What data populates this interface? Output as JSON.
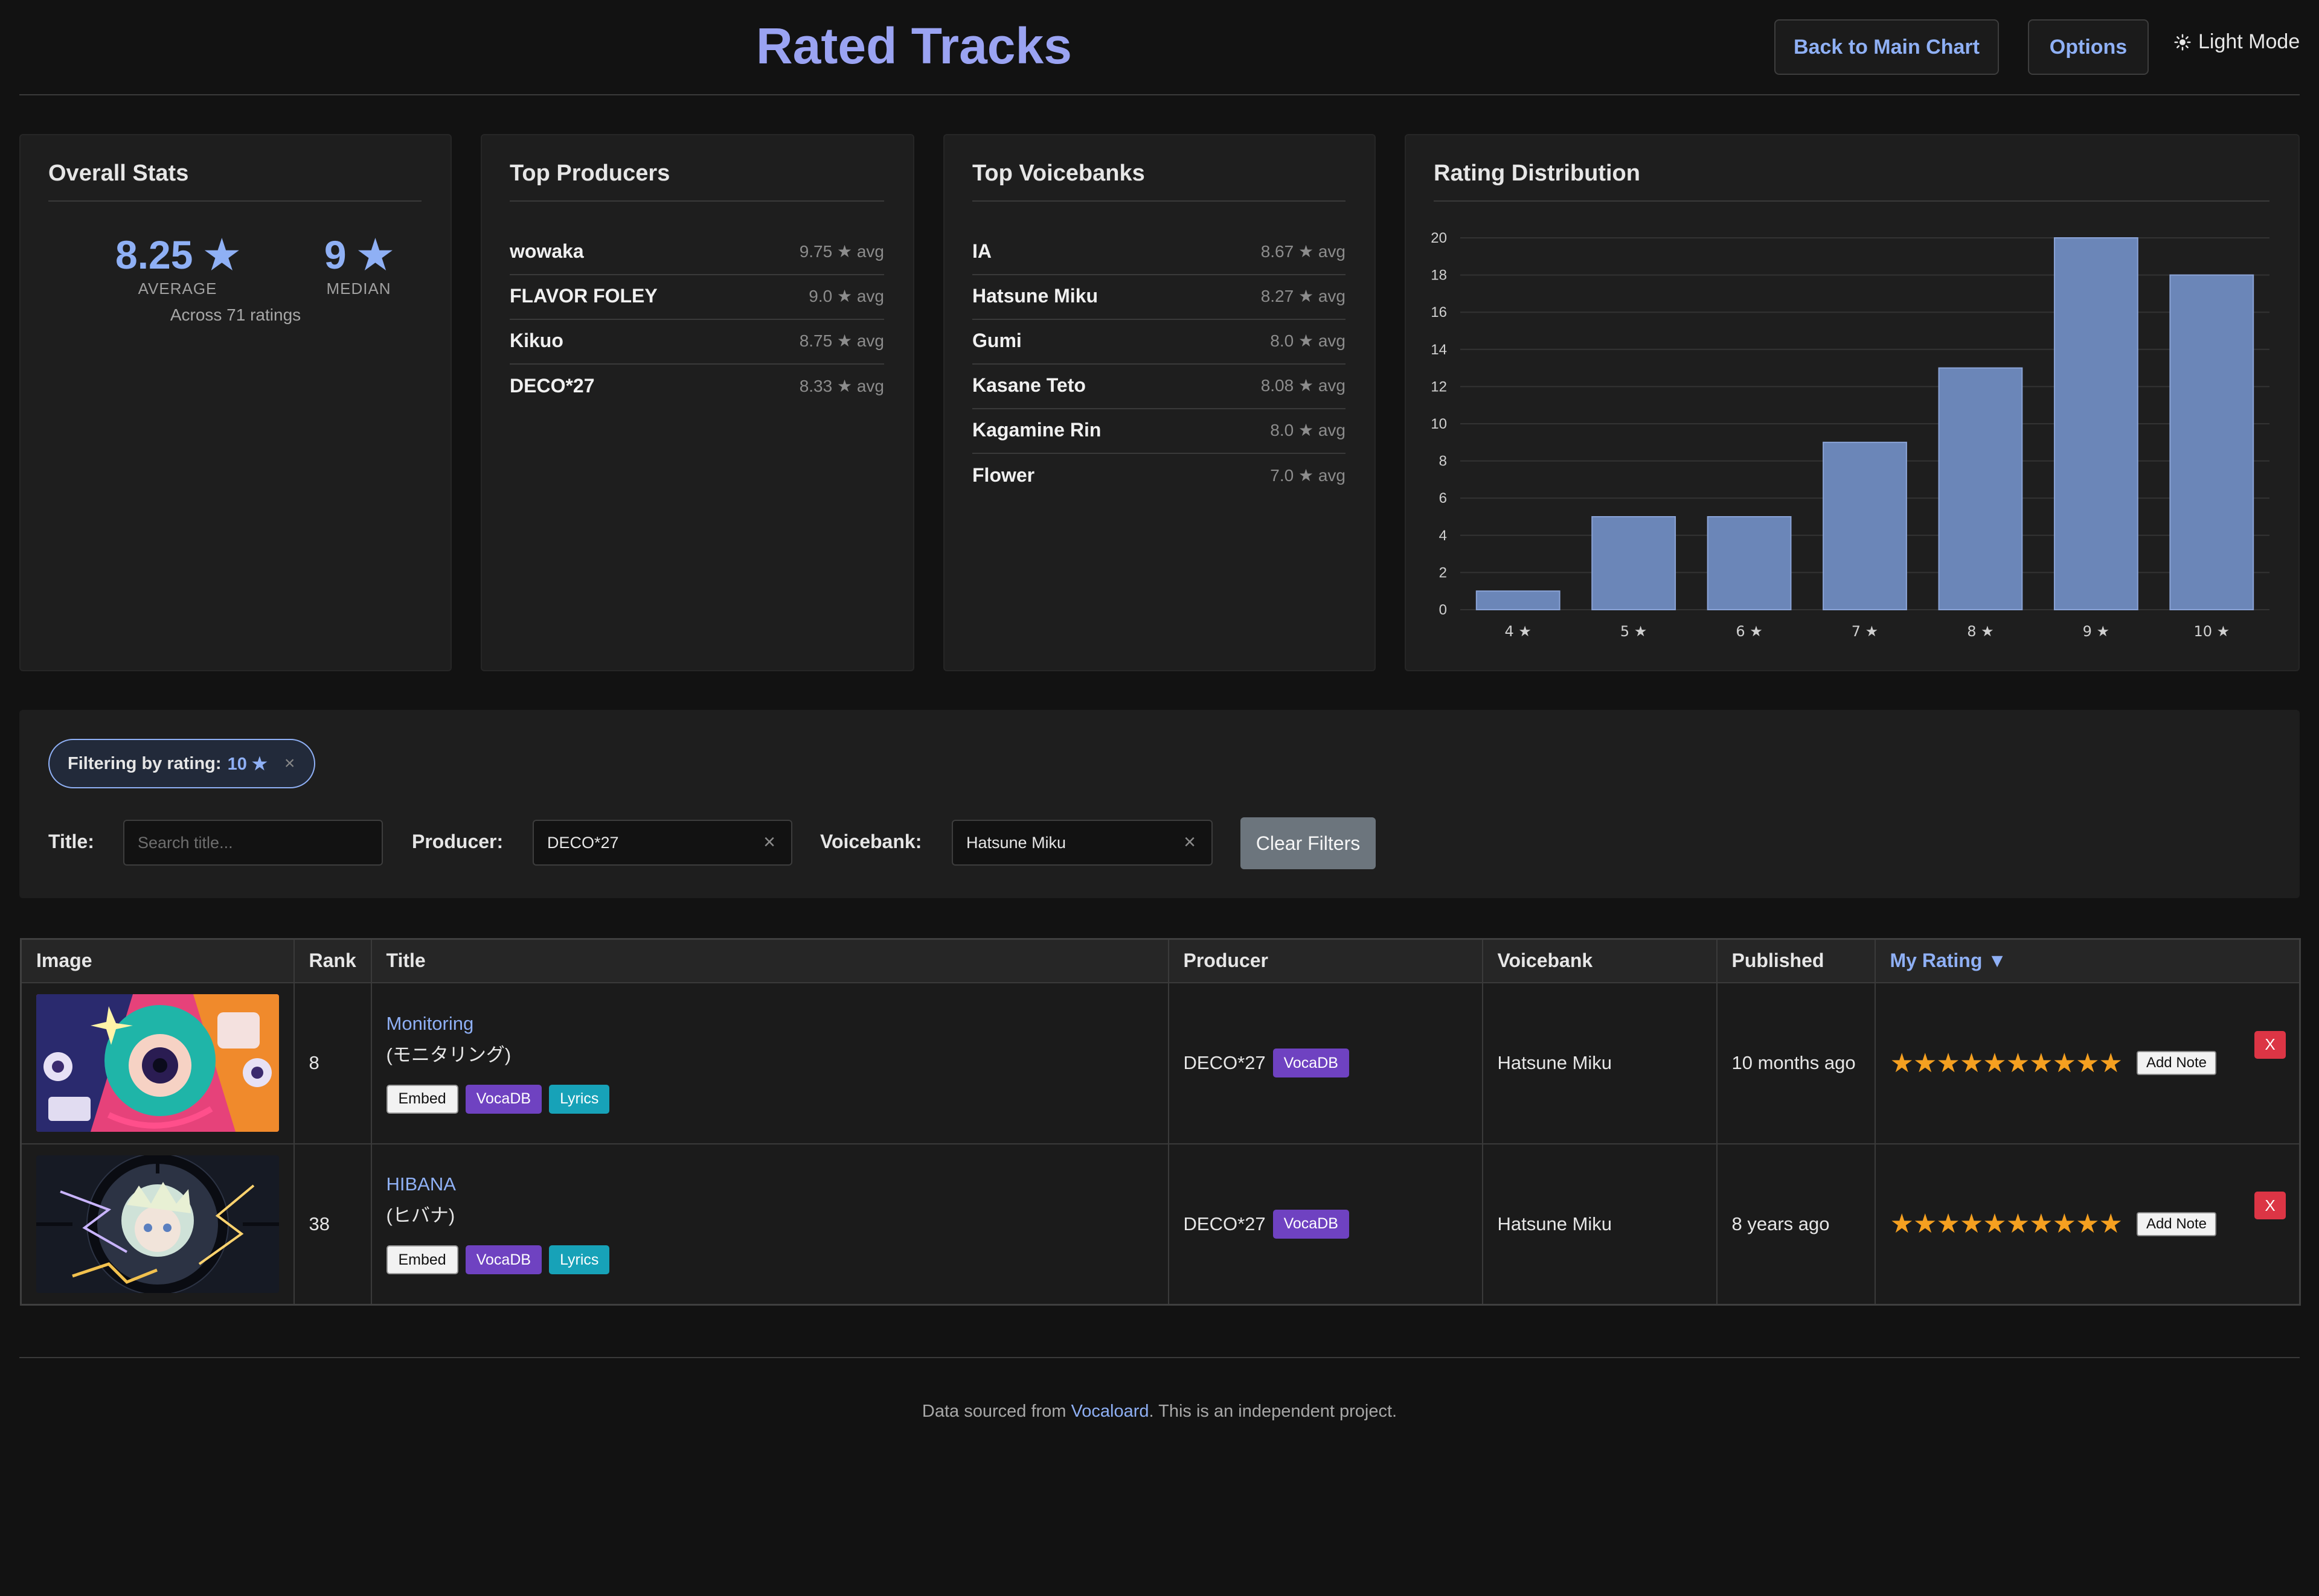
{
  "header": {
    "title": "Rated Tracks",
    "back_label": "Back to Main Chart",
    "options_label": "Options",
    "theme_label": "Light Mode"
  },
  "overall_stats": {
    "title": "Overall Stats",
    "average_value": "8.25 ★",
    "average_label": "AVERAGE",
    "median_value": "9 ★",
    "median_label": "MEDIAN",
    "caption": "Across 71 ratings"
  },
  "top_producers": {
    "title": "Top Producers",
    "items": [
      {
        "name": "wowaka",
        "avg": "9.75 ★ avg"
      },
      {
        "name": "FLAVOR FOLEY",
        "avg": "9.0 ★ avg"
      },
      {
        "name": "Kikuo",
        "avg": "8.75 ★ avg"
      },
      {
        "name": "DECO*27",
        "avg": "8.33 ★ avg"
      }
    ]
  },
  "top_voicebanks": {
    "title": "Top Voicebanks",
    "items": [
      {
        "name": "IA",
        "avg": "8.67 ★ avg"
      },
      {
        "name": "Hatsune Miku",
        "avg": "8.27 ★ avg"
      },
      {
        "name": "Gumi",
        "avg": "8.0 ★ avg"
      },
      {
        "name": "Kasane Teto",
        "avg": "8.08 ★ avg"
      },
      {
        "name": "Kagamine Rin",
        "avg": "8.0 ★ avg"
      },
      {
        "name": "Flower",
        "avg": "7.0 ★ avg"
      }
    ]
  },
  "rating_distribution": {
    "title": "Rating Distribution"
  },
  "chart_data": {
    "type": "bar",
    "title": "Rating Distribution",
    "categories": [
      "4 ★",
      "5 ★",
      "6 ★",
      "7 ★",
      "8 ★",
      "9 ★",
      "10 ★"
    ],
    "values": [
      1,
      5,
      5,
      9,
      13,
      20,
      18
    ],
    "ylim": [
      0,
      20
    ],
    "yticks": [
      0,
      2,
      4,
      6,
      8,
      10,
      12,
      14,
      16,
      18,
      20
    ],
    "grid": true,
    "bar_color": "#6b86b8"
  },
  "filters": {
    "pill_prefix": "Filtering by rating:",
    "pill_value": "10 ★",
    "pill_close": "×",
    "title_label": "Title:",
    "title_placeholder": "Search title...",
    "producer_label": "Producer:",
    "producer_value": "DECO*27",
    "voicebank_label": "Voicebank:",
    "voicebank_value": "Hatsune Miku",
    "clear_x": "×",
    "clear_button": "Clear Filters"
  },
  "table": {
    "headers": [
      "Image",
      "Rank",
      "Title",
      "Producer",
      "Voicebank",
      "Published",
      "My Rating ▼"
    ],
    "rows": [
      {
        "rank": "8",
        "title": "Monitoring",
        "title_sub": "(モニタリング)",
        "producer": "DECO*27",
        "voicebank": "Hatsune Miku",
        "published": "10 months ago",
        "stars": "★★★★★★★★★★"
      },
      {
        "rank": "38",
        "title": "HIBANA",
        "title_sub": "(ヒバナ)",
        "producer": "DECO*27",
        "voicebank": "Hatsune Miku",
        "published": "8 years ago",
        "stars": "★★★★★★★★★★"
      }
    ],
    "badge_embed": "Embed",
    "badge_vocadb": "VocaDB",
    "badge_lyrics": "Lyrics",
    "add_note": "Add Note",
    "delete": "X"
  },
  "footer": {
    "prefix": "Data sourced from ",
    "link": "Vocaloard",
    "suffix": ". This is an independent project."
  },
  "colors": {
    "background": "#121212",
    "card": "#1e1e1e",
    "accent": "#8fb0f5",
    "title": "#9aa3f2",
    "star": "#f5a020",
    "vocadb": "#6f42c1",
    "lyrics": "#17a2b8",
    "delete": "#dc3545"
  }
}
